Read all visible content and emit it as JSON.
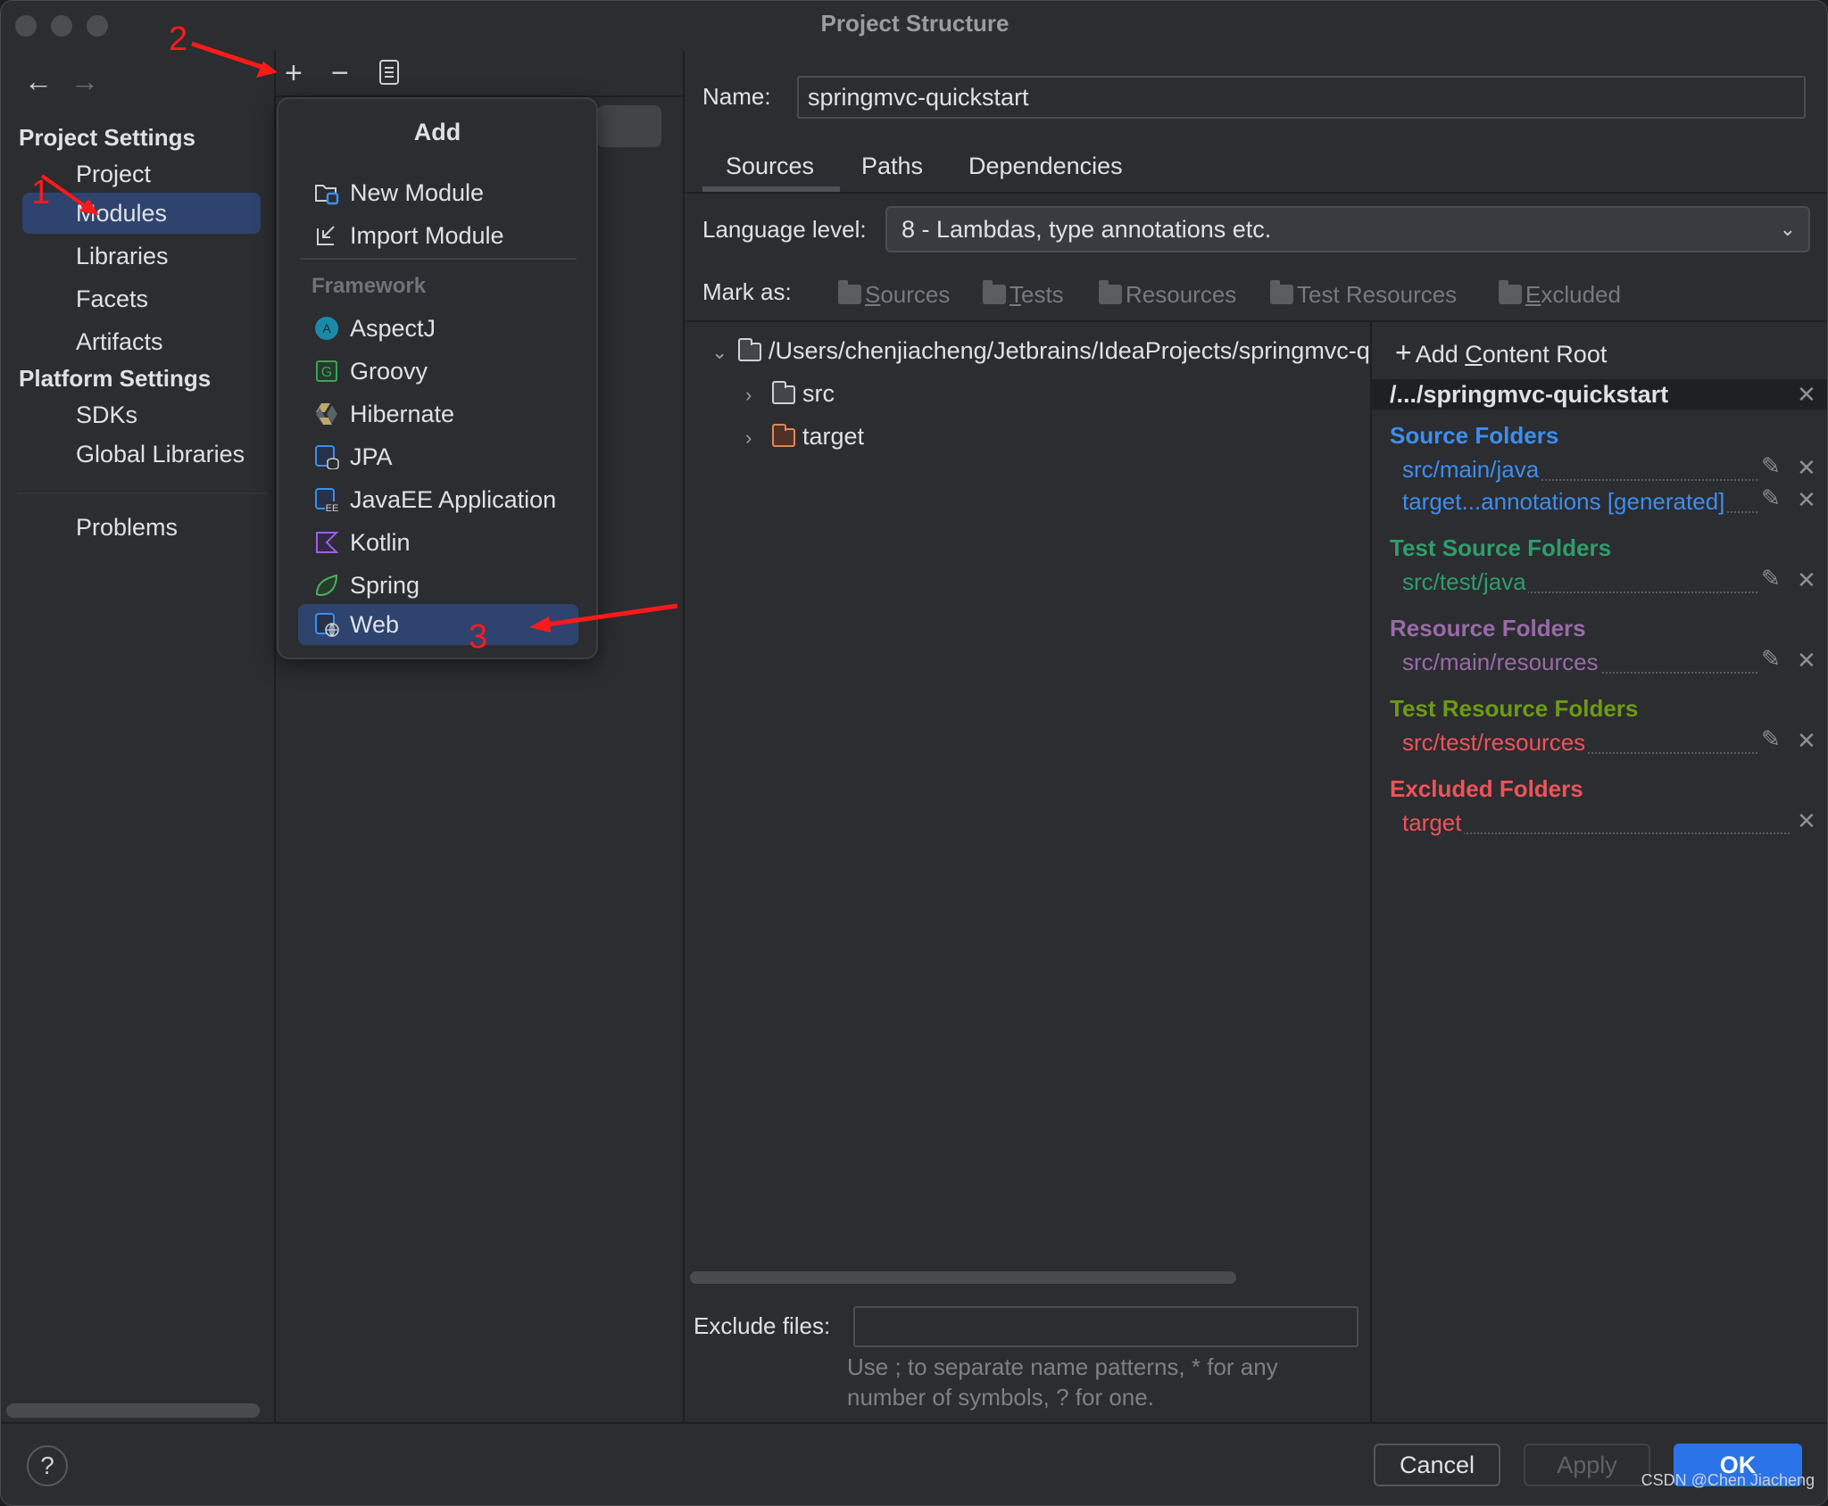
{
  "window": {
    "title": "Project Structure"
  },
  "sidebar": {
    "project_settings_header": "Project Settings",
    "project_items": [
      {
        "label": "Project",
        "selected": false
      },
      {
        "label": "Modules",
        "selected": true
      },
      {
        "label": "Libraries",
        "selected": false
      },
      {
        "label": "Facets",
        "selected": false
      },
      {
        "label": "Artifacts",
        "selected": false
      }
    ],
    "platform_settings_header": "Platform Settings",
    "platform_items": [
      {
        "label": "SDKs"
      },
      {
        "label": "Global Libraries"
      }
    ],
    "problems_label": "Problems"
  },
  "toolbar": {
    "back_icon": "arrow-left-icon",
    "forward_icon": "arrow-right-icon",
    "add_icon": "plus-icon",
    "remove_icon": "minus-icon",
    "copy_icon": "copy-icon"
  },
  "add_popup": {
    "title": "Add",
    "module_items": [
      {
        "label": "New Module",
        "icon": "new-module-icon"
      },
      {
        "label": "Import Module",
        "icon": "import-module-icon"
      }
    ],
    "framework_header": "Framework",
    "framework_items": [
      {
        "label": "AspectJ",
        "icon": "aspectj-icon"
      },
      {
        "label": "Groovy",
        "icon": "groovy-icon"
      },
      {
        "label": "Hibernate",
        "icon": "hibernate-icon"
      },
      {
        "label": "JPA",
        "icon": "jpa-icon"
      },
      {
        "label": "JavaEE Application",
        "icon": "javaee-icon"
      },
      {
        "label": "Kotlin",
        "icon": "kotlin-icon"
      },
      {
        "label": "Spring",
        "icon": "spring-icon"
      },
      {
        "label": "Web",
        "icon": "web-icon",
        "selected": true
      }
    ]
  },
  "module": {
    "name_label": "Name:",
    "name_value": "springmvc-quickstart",
    "tabs": [
      {
        "label": "Sources",
        "active": true
      },
      {
        "label": "Paths",
        "active": false
      },
      {
        "label": "Dependencies",
        "active": false
      }
    ],
    "language_level_label": "Language level:",
    "language_level_value": "8 - Lambdas, type annotations etc.",
    "mark_as_label": "Mark as:",
    "mark_as_buttons": [
      {
        "label": "Sources",
        "mnemonic": "S",
        "rest": "ources"
      },
      {
        "label": "Tests",
        "mnemonic": "T",
        "rest": "ests"
      },
      {
        "label": "Resources",
        "mnemonic": "",
        "rest": "Resources"
      },
      {
        "label": "Test Resources",
        "mnemonic": "",
        "rest": "Test Resources"
      },
      {
        "label": "Excluded",
        "mnemonic": "E",
        "rest": "xcluded"
      }
    ],
    "tree": {
      "root": "/Users/chenjiacheng/Jetbrains/IdeaProjects/springmvc-quickstart",
      "children": [
        {
          "label": "src",
          "color": "default"
        },
        {
          "label": "target",
          "color": "excluded"
        }
      ]
    },
    "exclude_files_label": "Exclude files:",
    "exclude_files_value": "",
    "exclude_hint_line1": "Use ; to separate name patterns, * for any",
    "exclude_hint_line2": "number of symbols, ? for one."
  },
  "content_root": {
    "add_label_pre": "Add ",
    "add_label_mnemonic": "C",
    "add_label_post": "ontent Root",
    "root_title": "/.../springmvc-quickstart",
    "sections": [
      {
        "title": "Source Folders",
        "color": "#3d8ef0",
        "entries": [
          "src/main/java",
          "target...annotations [generated]"
        ]
      },
      {
        "title": "Test Source Folders",
        "color": "#2f9e6b",
        "entries": [
          "src/test/java"
        ]
      },
      {
        "title": "Resource Folders",
        "color": "#9a6aa8",
        "entries": [
          "src/main/resources"
        ]
      },
      {
        "title": "Test Resource Folders",
        "color": "#6e9a14",
        "entry_color": "#f0525a",
        "entries": [
          "src/test/resources"
        ]
      },
      {
        "title": "Excluded Folders",
        "color": "#f0525a",
        "entries": [
          "target"
        ]
      }
    ]
  },
  "footer": {
    "help": "?",
    "cancel": "Cancel",
    "apply": "Apply",
    "ok": "OK"
  },
  "annotations": {
    "step1": "1",
    "step2": "2",
    "step3": "3"
  },
  "watermark": "CSDN @Chen Jiacheng"
}
